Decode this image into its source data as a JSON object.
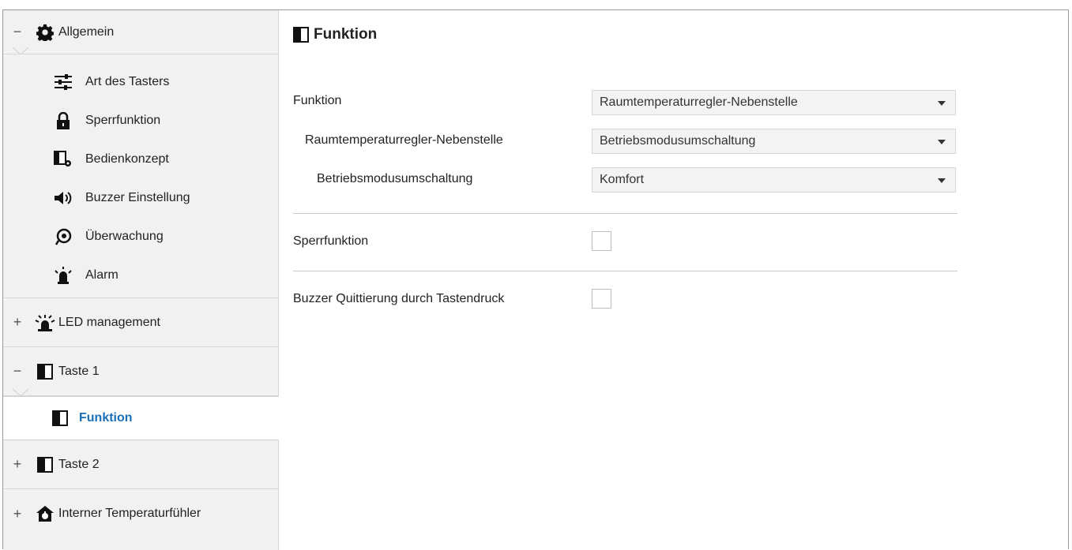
{
  "sidebar": {
    "allgemein": {
      "toggle": "−",
      "label": "Allgemein",
      "icon": "gear-icon",
      "items": [
        {
          "label": "Art des Tasters",
          "icon": "sliders-icon"
        },
        {
          "label": "Sperrfunktion",
          "icon": "lock-icon"
        },
        {
          "label": "Bedienkonzept",
          "icon": "panel-gear-icon"
        },
        {
          "label": "Buzzer Einstellung",
          "icon": "speaker-icon"
        },
        {
          "label": "Überwachung",
          "icon": "eye-icon"
        },
        {
          "label": "Alarm",
          "icon": "alarm-icon"
        }
      ]
    },
    "led": {
      "toggle": "+",
      "label": "LED management",
      "icon": "led-icon"
    },
    "taste1": {
      "toggle": "−",
      "label": "Taste 1",
      "icon": "button-panel-icon"
    },
    "taste1_active": {
      "label": "Funktion",
      "icon": "button-panel-icon"
    },
    "taste2": {
      "toggle": "+",
      "label": "Taste 2",
      "icon": "button-panel-icon"
    },
    "temp": {
      "toggle": "+",
      "label": "Interner Temperaturfühler",
      "icon": "house-thermo-icon"
    }
  },
  "main": {
    "title": "Funktion",
    "rows": {
      "funktion": {
        "label": "Funktion",
        "value": "Raumtemperaturregler-Nebenstelle"
      },
      "nebenstelle": {
        "label": "Raumtemperaturregler-Nebenstelle",
        "value": "Betriebsmodusumschaltung"
      },
      "betrieb": {
        "label": "Betriebsmodusumschaltung",
        "value": "Komfort"
      },
      "sperr": {
        "label": "Sperrfunktion",
        "checked": false
      },
      "buzzer": {
        "label": "Buzzer Quittierung durch Tastendruck",
        "checked": false
      }
    }
  },
  "colors": {
    "active_text": "#1a6fb8",
    "sidebar_bg": "#f1f1f1",
    "select_bg": "#f3f3f3"
  }
}
